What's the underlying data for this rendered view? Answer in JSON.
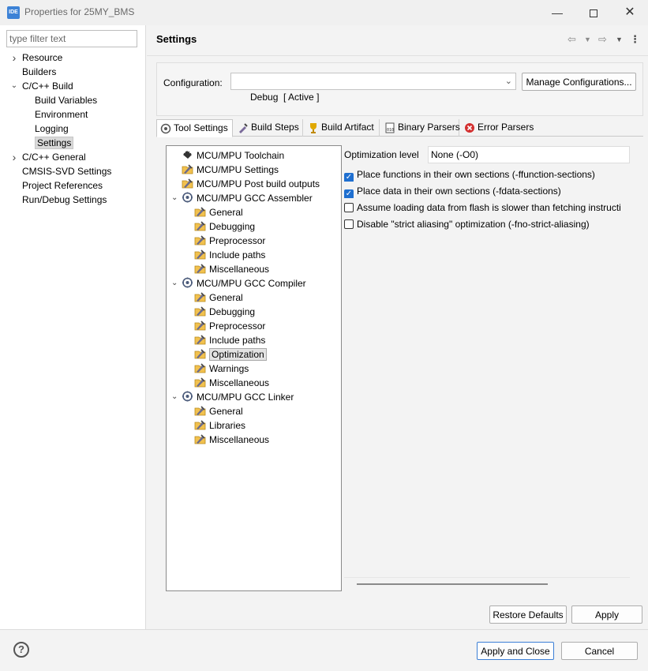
{
  "window": {
    "title": "Properties for 25MY_BMS",
    "app_icon_text": "IDE",
    "minimize_icon": "minimize-icon",
    "maximize_icon": "maximize-icon",
    "close_icon": "close-icon"
  },
  "filter": {
    "placeholder": "type filter text",
    "value": ""
  },
  "nav": {
    "items": [
      {
        "label": "Resource",
        "expandable": true,
        "expanded": false
      },
      {
        "label": "Builders"
      },
      {
        "label": "C/C++ Build",
        "expandable": true,
        "expanded": true
      },
      {
        "label": "Build Variables"
      },
      {
        "label": "Environment"
      },
      {
        "label": "Logging"
      },
      {
        "label": "Settings",
        "selected": true
      },
      {
        "label": "C/C++ General",
        "expandable": true,
        "expanded": false
      },
      {
        "label": "CMSIS-SVD Settings"
      },
      {
        "label": "Project References"
      },
      {
        "label": "Run/Debug Settings"
      }
    ]
  },
  "page": {
    "title": "Settings"
  },
  "configuration": {
    "label": "Configuration:",
    "value": "Debug  [ Active ]",
    "manage_button": "Manage Configurations..."
  },
  "tabs": [
    {
      "label": "Tool Settings",
      "icon": "tool-settings-icon",
      "active": true
    },
    {
      "label": "Build Steps",
      "icon": "build-steps-icon"
    },
    {
      "label": "Build Artifact",
      "icon": "build-artifact-icon"
    },
    {
      "label": "Binary Parsers",
      "icon": "binary-parsers-icon"
    },
    {
      "label": "Error Parsers",
      "icon": "error-parsers-icon"
    }
  ],
  "tree": {
    "items": [
      {
        "label": "MCU/MPU Toolchain",
        "level": 0,
        "icon": "chip-icon"
      },
      {
        "label": "MCU/MPU Settings",
        "level": 0,
        "icon": "settings-folder-icon"
      },
      {
        "label": "MCU/MPU Post build outputs",
        "level": 0,
        "icon": "settings-folder-icon"
      },
      {
        "label": "MCU/MPU GCC Assembler",
        "level": 0,
        "icon": "tool-icon",
        "expanded": true
      },
      {
        "label": "General",
        "level": 1,
        "icon": "settings-folder-icon"
      },
      {
        "label": "Debugging",
        "level": 1,
        "icon": "settings-folder-icon"
      },
      {
        "label": "Preprocessor",
        "level": 1,
        "icon": "settings-folder-icon"
      },
      {
        "label": "Include paths",
        "level": 1,
        "icon": "settings-folder-icon"
      },
      {
        "label": "Miscellaneous",
        "level": 1,
        "icon": "settings-folder-icon"
      },
      {
        "label": "MCU/MPU GCC Compiler",
        "level": 0,
        "icon": "tool-icon",
        "expanded": true
      },
      {
        "label": "General",
        "level": 1,
        "icon": "settings-folder-icon"
      },
      {
        "label": "Debugging",
        "level": 1,
        "icon": "settings-folder-icon"
      },
      {
        "label": "Preprocessor",
        "level": 1,
        "icon": "settings-folder-icon"
      },
      {
        "label": "Include paths",
        "level": 1,
        "icon": "settings-folder-icon"
      },
      {
        "label": "Optimization",
        "level": 1,
        "icon": "settings-folder-icon",
        "selected": true
      },
      {
        "label": "Warnings",
        "level": 1,
        "icon": "settings-folder-icon"
      },
      {
        "label": "Miscellaneous",
        "level": 1,
        "icon": "settings-folder-icon"
      },
      {
        "label": "MCU/MPU GCC Linker",
        "level": 0,
        "icon": "tool-icon",
        "expanded": true
      },
      {
        "label": "General",
        "level": 1,
        "icon": "settings-folder-icon"
      },
      {
        "label": "Libraries",
        "level": 1,
        "icon": "settings-folder-icon"
      },
      {
        "label": "Miscellaneous",
        "level": 1,
        "icon": "settings-folder-icon"
      }
    ]
  },
  "optimization": {
    "level_label": "Optimization level",
    "level_value": "None (-O0)",
    "options": [
      {
        "label": "Place functions in their own sections (-ffunction-sections)",
        "checked": true
      },
      {
        "label": "Place data in their own sections (-fdata-sections)",
        "checked": true
      },
      {
        "label": "Assume loading data from flash is slower than fetching instructi",
        "checked": false
      },
      {
        "label": "Disable \"strict aliasing\" optimization (-fno-strict-aliasing)",
        "checked": false
      }
    ]
  },
  "buttons": {
    "restore_defaults": "Restore Defaults",
    "apply": "Apply",
    "apply_close": "Apply and Close",
    "cancel": "Cancel"
  },
  "colors": {
    "accent": "#1f6fd0",
    "default_button_border": "#3c7fd6"
  }
}
